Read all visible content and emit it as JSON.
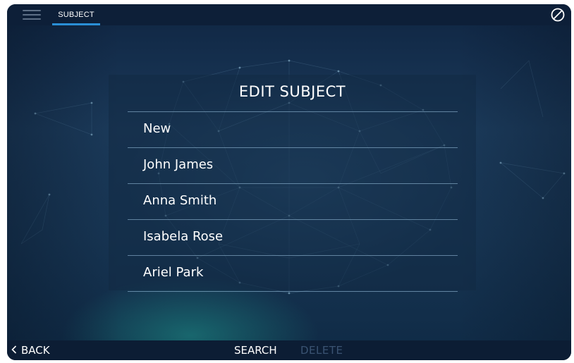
{
  "topbar": {
    "menu_icon": "hamburger-menu-icon",
    "tab_label": "SUBJECT",
    "right_icon": "prohibited-circle-icon"
  },
  "panel": {
    "title": "EDIT SUBJECT",
    "items": [
      {
        "label": "New"
      },
      {
        "label": "John James"
      },
      {
        "label": "Anna Smith"
      },
      {
        "label": "Isabela Rose"
      },
      {
        "label": "Ariel Park"
      }
    ]
  },
  "bottombar": {
    "back_icon": "chevron-left-icon",
    "back_label": "BACK",
    "search_label": "SEARCH",
    "delete_label": "DELETE",
    "delete_disabled": true
  },
  "colors": {
    "accent": "#2a8fd6",
    "background": "#1b3a5a",
    "disabled_text": "#3a5372"
  }
}
